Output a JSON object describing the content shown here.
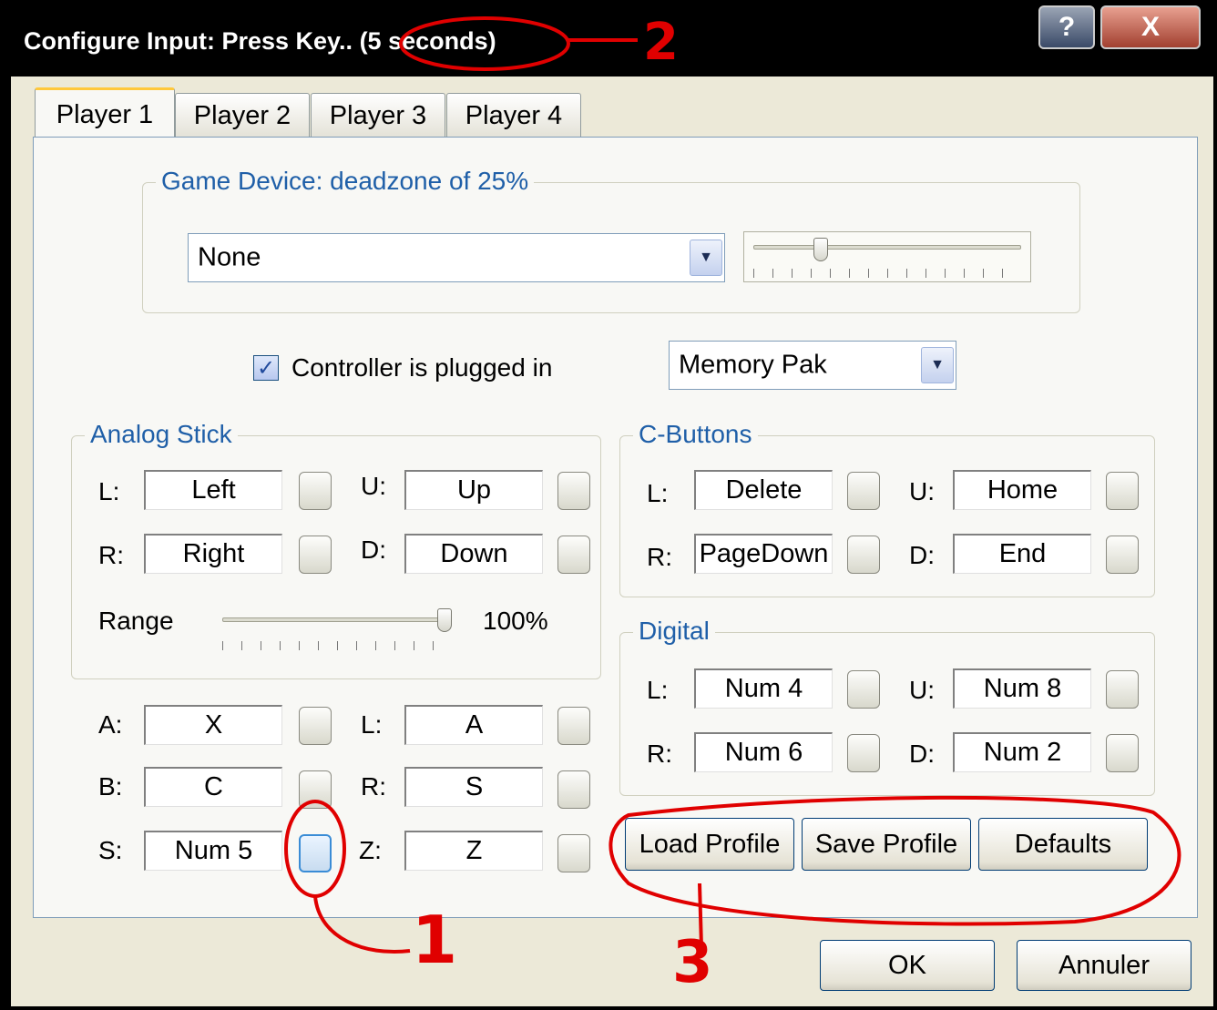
{
  "window": {
    "title": "Configure Input: Press Key..",
    "countdown": "(5 seconds)",
    "help_button": "?",
    "close_button": "X"
  },
  "tabs": [
    "Player 1",
    "Player 2",
    "Player 3",
    "Player 4"
  ],
  "active_tab": "Player 1",
  "game_device": {
    "group_title": "Game Device: deadzone of 25%",
    "device_selected": "None",
    "deadzone_percent": 25
  },
  "controller": {
    "plugged_in_label": "Controller is plugged in",
    "plugged_in_checked": true,
    "pak_selected": "Memory Pak"
  },
  "analog_stick": {
    "group_title": "Analog Stick",
    "labels": {
      "l": "L:",
      "r": "R:",
      "u": "U:",
      "d": "D:"
    },
    "values": {
      "l": "Left",
      "r": "Right",
      "u": "Up",
      "d": "Down"
    },
    "range_label": "Range",
    "range_value": "100%",
    "range_percent": 100
  },
  "main_buttons": {
    "labels": {
      "a": "A:",
      "b": "B:",
      "s": "S:",
      "l": "L:",
      "r": "R:",
      "z": "Z:"
    },
    "values": {
      "a": "X",
      "b": "C",
      "s": "Num 5",
      "l": "A",
      "r": "S",
      "z": "Z"
    }
  },
  "c_buttons": {
    "group_title": "C-Buttons",
    "labels": {
      "l": "L:",
      "r": "R:",
      "u": "U:",
      "d": "D:"
    },
    "values": {
      "l": "Delete",
      "r": "PageDown",
      "u": "Home",
      "d": "End"
    }
  },
  "digital": {
    "group_title": "Digital",
    "labels": {
      "l": "L:",
      "r": "R:",
      "u": "U:",
      "d": "D:"
    },
    "values": {
      "l": "Num 4",
      "r": "Num 6",
      "u": "Num 8",
      "d": "Num 2"
    }
  },
  "profile_buttons": {
    "load": "Load Profile",
    "save": "Save Profile",
    "defaults": "Defaults"
  },
  "footer": {
    "ok": "OK",
    "cancel": "Annuler"
  },
  "annotations": {
    "mark_1": "1",
    "mark_2": "2",
    "mark_3": "3",
    "color": "#e00000"
  }
}
